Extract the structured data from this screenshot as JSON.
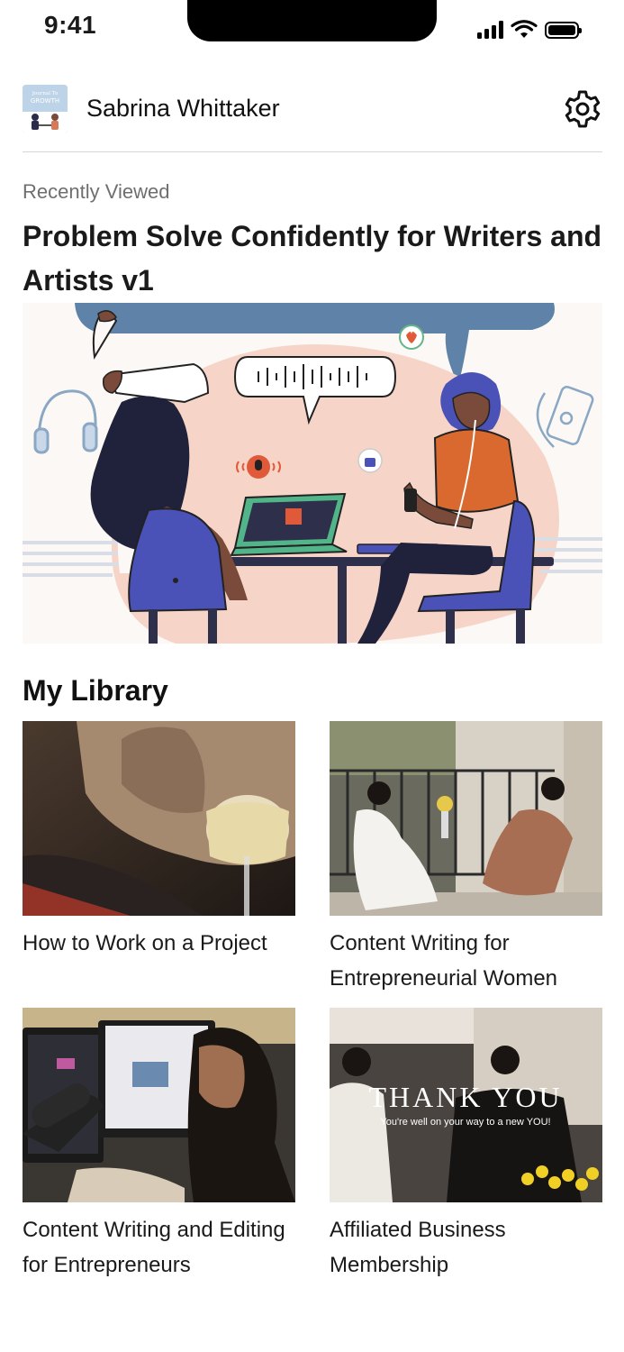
{
  "status": {
    "time": "9:41"
  },
  "header": {
    "user_name": "Sabrina Whittaker",
    "avatar_text_line1": "Journal To",
    "avatar_text_line2": "GROWTH",
    "settings_icon": "gear-icon"
  },
  "recently_viewed": {
    "label": "Recently Viewed",
    "title": "Problem Solve Confidently for Writers and Artists v1"
  },
  "library": {
    "heading": "My Library",
    "items": [
      {
        "title": "How to Work on a Project"
      },
      {
        "title": "Content Writing for Entrepreneurial Women"
      },
      {
        "title": "Content Writing and Editing for Entrepreneurs"
      },
      {
        "title": "Affiliated Business Membership",
        "image_text_line1": "THANK YOU",
        "image_text_line2": "You're well on your way to a new YOU!"
      }
    ]
  },
  "colors": {
    "accent_blue": "#5f83a8",
    "peach": "#f6d5c8",
    "chair": "#4a52b8"
  }
}
